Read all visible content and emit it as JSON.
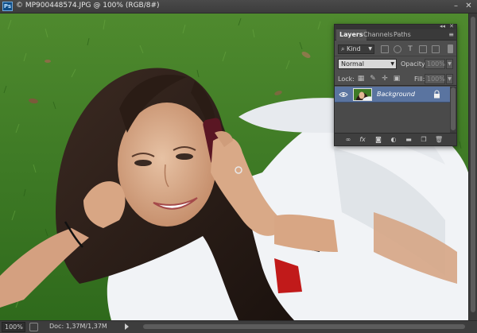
{
  "window": {
    "app_badge": "Ps",
    "title": "© MP900448574.JPG @ 100% (RGB/8#)",
    "minimize_glyph": "–",
    "close_glyph": "✕"
  },
  "status": {
    "zoom": "100%",
    "doc_info": "Doc: 1,37M/1,37M"
  },
  "layers_panel": {
    "tabs": [
      {
        "label": "Layers",
        "active": true
      },
      {
        "label": "Channels",
        "active": false
      },
      {
        "label": "Paths",
        "active": false
      }
    ],
    "collapse_glyph": "◂◂",
    "close_glyph": "✕",
    "menu_glyph": "≡",
    "filter": {
      "kind": "Kind",
      "icons": [
        "pixel-filter-icon",
        "adjustment-filter-icon",
        "type-filter-icon",
        "shape-filter-icon",
        "smart-object-filter-icon"
      ]
    },
    "blend_mode": "Normal",
    "opacity_label": "Opacity:",
    "opacity_value": "100%",
    "lock_label": "Lock:",
    "fill_label": "Fill:",
    "fill_value": "100%",
    "layers": [
      {
        "name": "Background",
        "visible": true,
        "locked": true,
        "selected": true
      }
    ],
    "footer_icons": [
      "link-layers-icon",
      "fx-icon",
      "add-mask-icon",
      "adjustment-layer-icon",
      "new-group-icon",
      "new-layer-icon",
      "delete-layer-icon"
    ]
  },
  "colors": {
    "chrome_dark": "#3c3c3c",
    "panel_bg": "#4e4e4e",
    "selection_blue": "#5a74a0"
  }
}
